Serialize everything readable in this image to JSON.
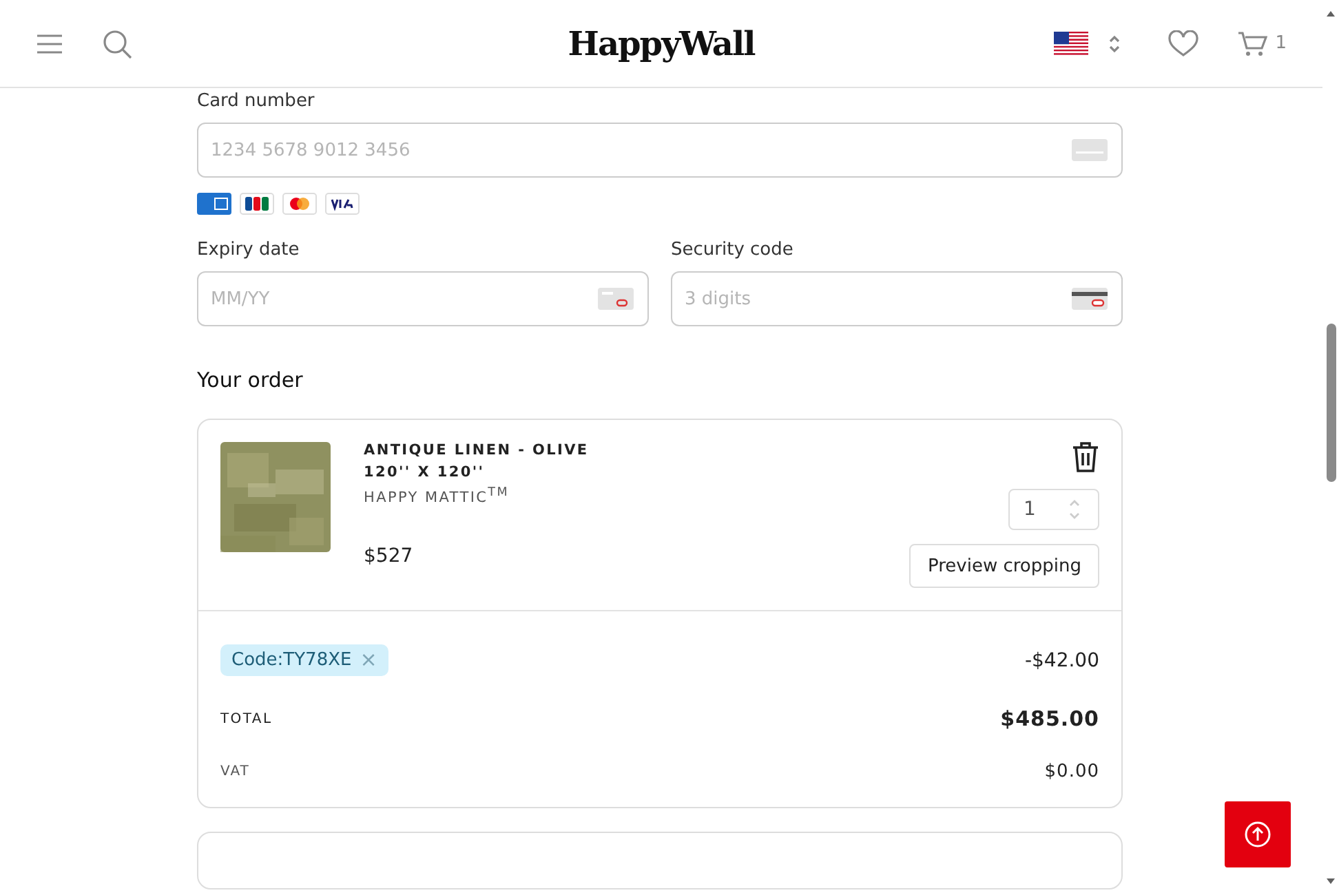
{
  "header": {
    "logo": "HappyWall",
    "cart_count": "1"
  },
  "payment": {
    "card_number": {
      "label": "Card number",
      "placeholder": "1234 5678 9012 3456"
    },
    "expiry": {
      "label": "Expiry date",
      "placeholder": "MM/YY"
    },
    "security": {
      "label": "Security code",
      "placeholder": "3 digits"
    }
  },
  "order": {
    "title": "Your order",
    "item": {
      "kind": "picture",
      "name": "ANTIQUE LINEN - OLIVE",
      "size": "120'' X 120''",
      "material": "HAPPY MATTIC$^{TM}$",
      "price": "$527",
      "quantity": "1",
      "preview_button": "Preview cropping"
    },
    "discount": {
      "code": "Code:TY78XE",
      "remove": "×",
      "amount": "-$42.00"
    },
    "total": {
      "label": "TOTAL",
      "value": "$485.00"
    },
    "vat": {
      "label": "VAT",
      "value": "$0.00"
    }
  }
}
